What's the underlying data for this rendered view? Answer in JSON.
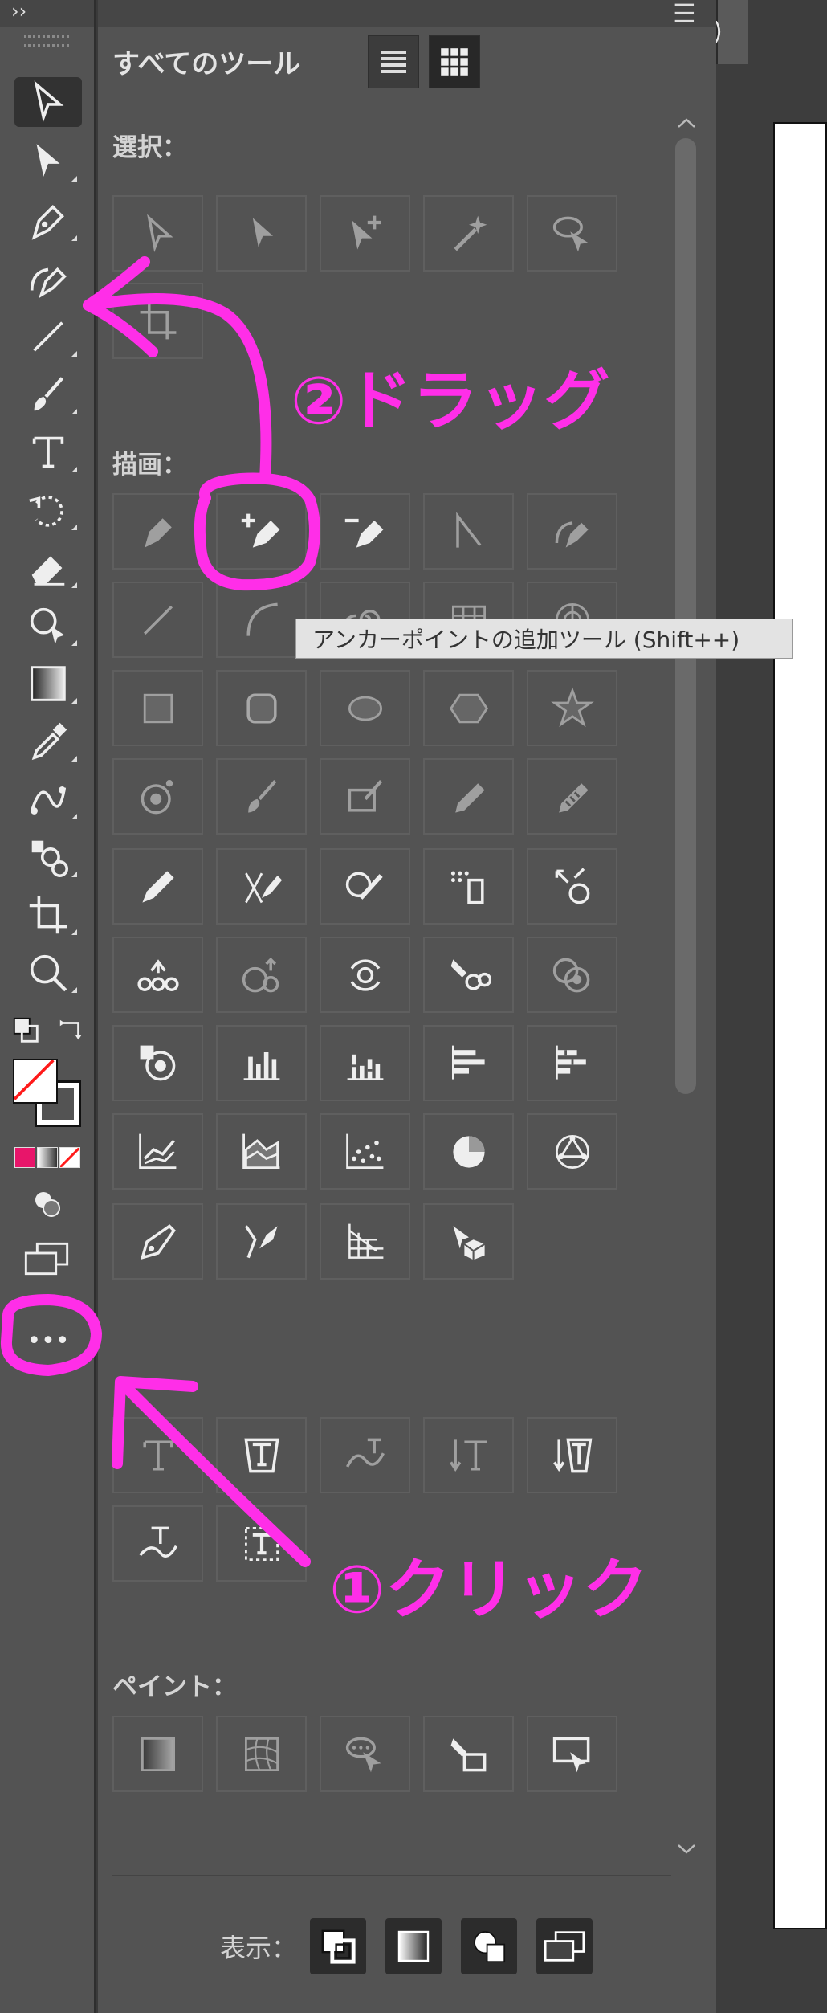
{
  "toolbar": {
    "collapse_glyph": "››",
    "tools": [
      {
        "name": "selection-tool-icon"
      },
      {
        "name": "direct-selection-tool-icon"
      },
      {
        "name": "pen-tool-icon"
      },
      {
        "name": "curvature-tool-icon"
      },
      {
        "name": "line-segment-tool-icon"
      },
      {
        "name": "paintbrush-tool-icon"
      },
      {
        "name": "type-tool-icon"
      },
      {
        "name": "rotate-tool-icon"
      },
      {
        "name": "eraser-tool-icon"
      },
      {
        "name": "shape-builder-tool-icon"
      },
      {
        "name": "gradient-tool-icon"
      },
      {
        "name": "eyedropper-tool-icon"
      },
      {
        "name": "blend-tool-icon"
      },
      {
        "name": "symbol-sprayer-tool-icon"
      },
      {
        "name": "artboard-tool-icon"
      },
      {
        "name": "zoom-tool-icon"
      }
    ],
    "more_tools_glyph": "•••"
  },
  "panel": {
    "title": "すべてのツール",
    "menu_glyph": "☰",
    "sections": {
      "select": "選択：",
      "draw": "描画：",
      "paint": "ペイント："
    },
    "tooltip": "アンカーポイントの追加ツール (Shift++)",
    "footer_label": "表示："
  },
  "document_tab": {
    "label": ")"
  },
  "annotations": {
    "drag": "②ドラッグ",
    "click": "①クリック"
  },
  "colors": {
    "panel_bg": "#535353",
    "annotation": "#ff2ee8",
    "fill_red_slash": "#ff1a1a"
  }
}
